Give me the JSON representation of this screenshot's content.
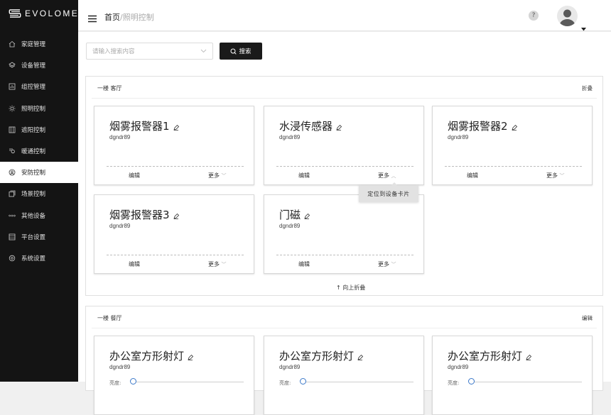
{
  "app": {
    "logo_text": "EVOLOME"
  },
  "sidebar": {
    "items": [
      {
        "label": "家庭管理",
        "icon": "home-icon"
      },
      {
        "label": "设备管理",
        "icon": "layers-icon"
      },
      {
        "label": "组控管理",
        "icon": "chart-icon"
      },
      {
        "label": "照明控制",
        "icon": "sun-icon"
      },
      {
        "label": "遮阳控制",
        "icon": "blinds-icon"
      },
      {
        "label": "暖通控制",
        "icon": "hvac-icon"
      },
      {
        "label": "安防控制",
        "icon": "security-icon",
        "active": true
      },
      {
        "label": "场景控制",
        "icon": "scene-icon"
      },
      {
        "label": "其他设备",
        "icon": "more-dots-icon"
      },
      {
        "label": "平台设置",
        "icon": "server-icon"
      },
      {
        "label": "系统设置",
        "icon": "settings-icon"
      }
    ]
  },
  "header": {
    "breadcrumb_home": "首页",
    "breadcrumb_sep": "/",
    "breadcrumb_current": "照明控制",
    "help": "?"
  },
  "search": {
    "placeholder": "请输入搜索内容",
    "button": "搜索"
  },
  "groups": [
    {
      "title": "一楼 客厅",
      "action": "折叠",
      "collapse_label": "向上折叠",
      "cards": [
        {
          "name": "烟雾报警器1",
          "code": "dgndr89",
          "edit": "编辑",
          "more": "更多"
        },
        {
          "name": "水浸传感器",
          "code": "dgndr89",
          "edit": "编辑",
          "more": "更多"
        },
        {
          "name": "烟雾报警器2",
          "code": "dgndr89",
          "edit": "编辑",
          "more": "更多"
        },
        {
          "name": "烟雾报警器3",
          "code": "dgndr89",
          "edit": "编辑",
          "more": "更多"
        },
        {
          "name": "门磁",
          "code": "dgndr89",
          "edit": "编辑",
          "more": "更多"
        }
      ]
    },
    {
      "title": "一楼 餐厅",
      "action": "编辑",
      "cards": [
        {
          "name": "办公室方形射灯",
          "code": "dgndr89",
          "slider_label": "亮度:"
        },
        {
          "name": "办公室方形射灯",
          "code": "dgndr89",
          "slider_label": "亮度:"
        },
        {
          "name": "办公室方形射灯",
          "code": "dgndr89",
          "slider_label": "亮度:"
        }
      ]
    }
  ],
  "more_menu": {
    "item": "定位到设备卡片"
  },
  "colors": {
    "sidebar_bg": "#141414",
    "primary_button": "#1a1a1a",
    "slider_accent": "#3a78c9"
  }
}
